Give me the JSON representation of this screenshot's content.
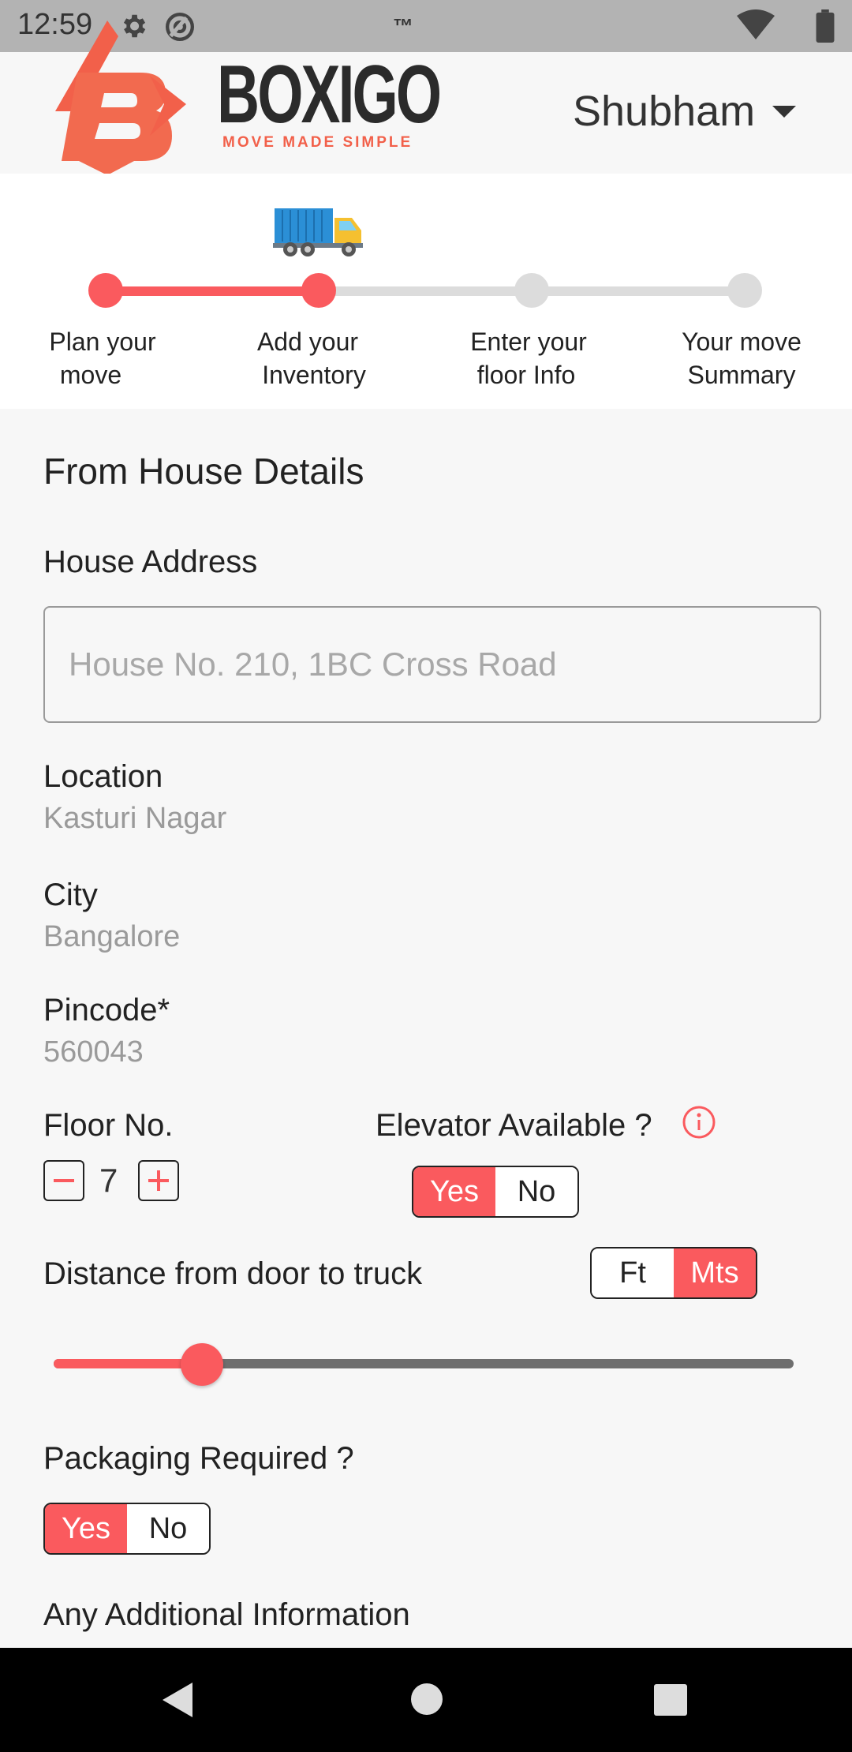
{
  "status_bar": {
    "time": "12:59",
    "tm": "™",
    "icons": [
      "gear-icon",
      "at-icon",
      "wifi-icon",
      "battery-icon"
    ]
  },
  "header": {
    "brand": "BOXIGO",
    "tagline": "MOVE MADE SIMPLE",
    "user_name": "Shubham"
  },
  "stepper": {
    "current_step": 2,
    "steps": [
      {
        "label_line1": "Plan your",
        "label_line2": "move"
      },
      {
        "label_line1": "Add your",
        "label_line2": "Inventory"
      },
      {
        "label_line1": "Enter your",
        "label_line2": "floor Info"
      },
      {
        "label_line1": "Your move",
        "label_line2": "Summary"
      }
    ]
  },
  "form": {
    "section_title": "From House Details",
    "house_address_label": "House Address",
    "house_address_placeholder": "House No. 210, 1BC Cross Road",
    "location_label": "Location",
    "location_value": "Kasturi Nagar",
    "city_label": "City",
    "city_value": "Bangalore",
    "pincode_label": "Pincode*",
    "pincode_value": "560043",
    "floor_label": "Floor No.",
    "floor_value": "7",
    "elevator_label": "Elevator Available ?",
    "elevator_yes": "Yes",
    "elevator_no": "No",
    "elevator_selected": "Yes",
    "distance_label": "Distance from door to truck",
    "unit_ft": "Ft",
    "unit_mts": "Mts",
    "unit_selected": "Mts",
    "distance_slider_fraction": 0.2,
    "packaging_label": "Packaging Required ?",
    "packaging_yes": "Yes",
    "packaging_no": "No",
    "packaging_selected": "Yes",
    "additional_info_label": "Any Additional Information"
  },
  "colors": {
    "accent": "#fa5a5e",
    "brand_orange": "#f2604a",
    "inactive_step": "#dcdcdc",
    "status_bar": "#b3b3b3"
  },
  "navigation_bar": {
    "icons": [
      "back-icon",
      "home-icon",
      "recents-icon"
    ]
  }
}
